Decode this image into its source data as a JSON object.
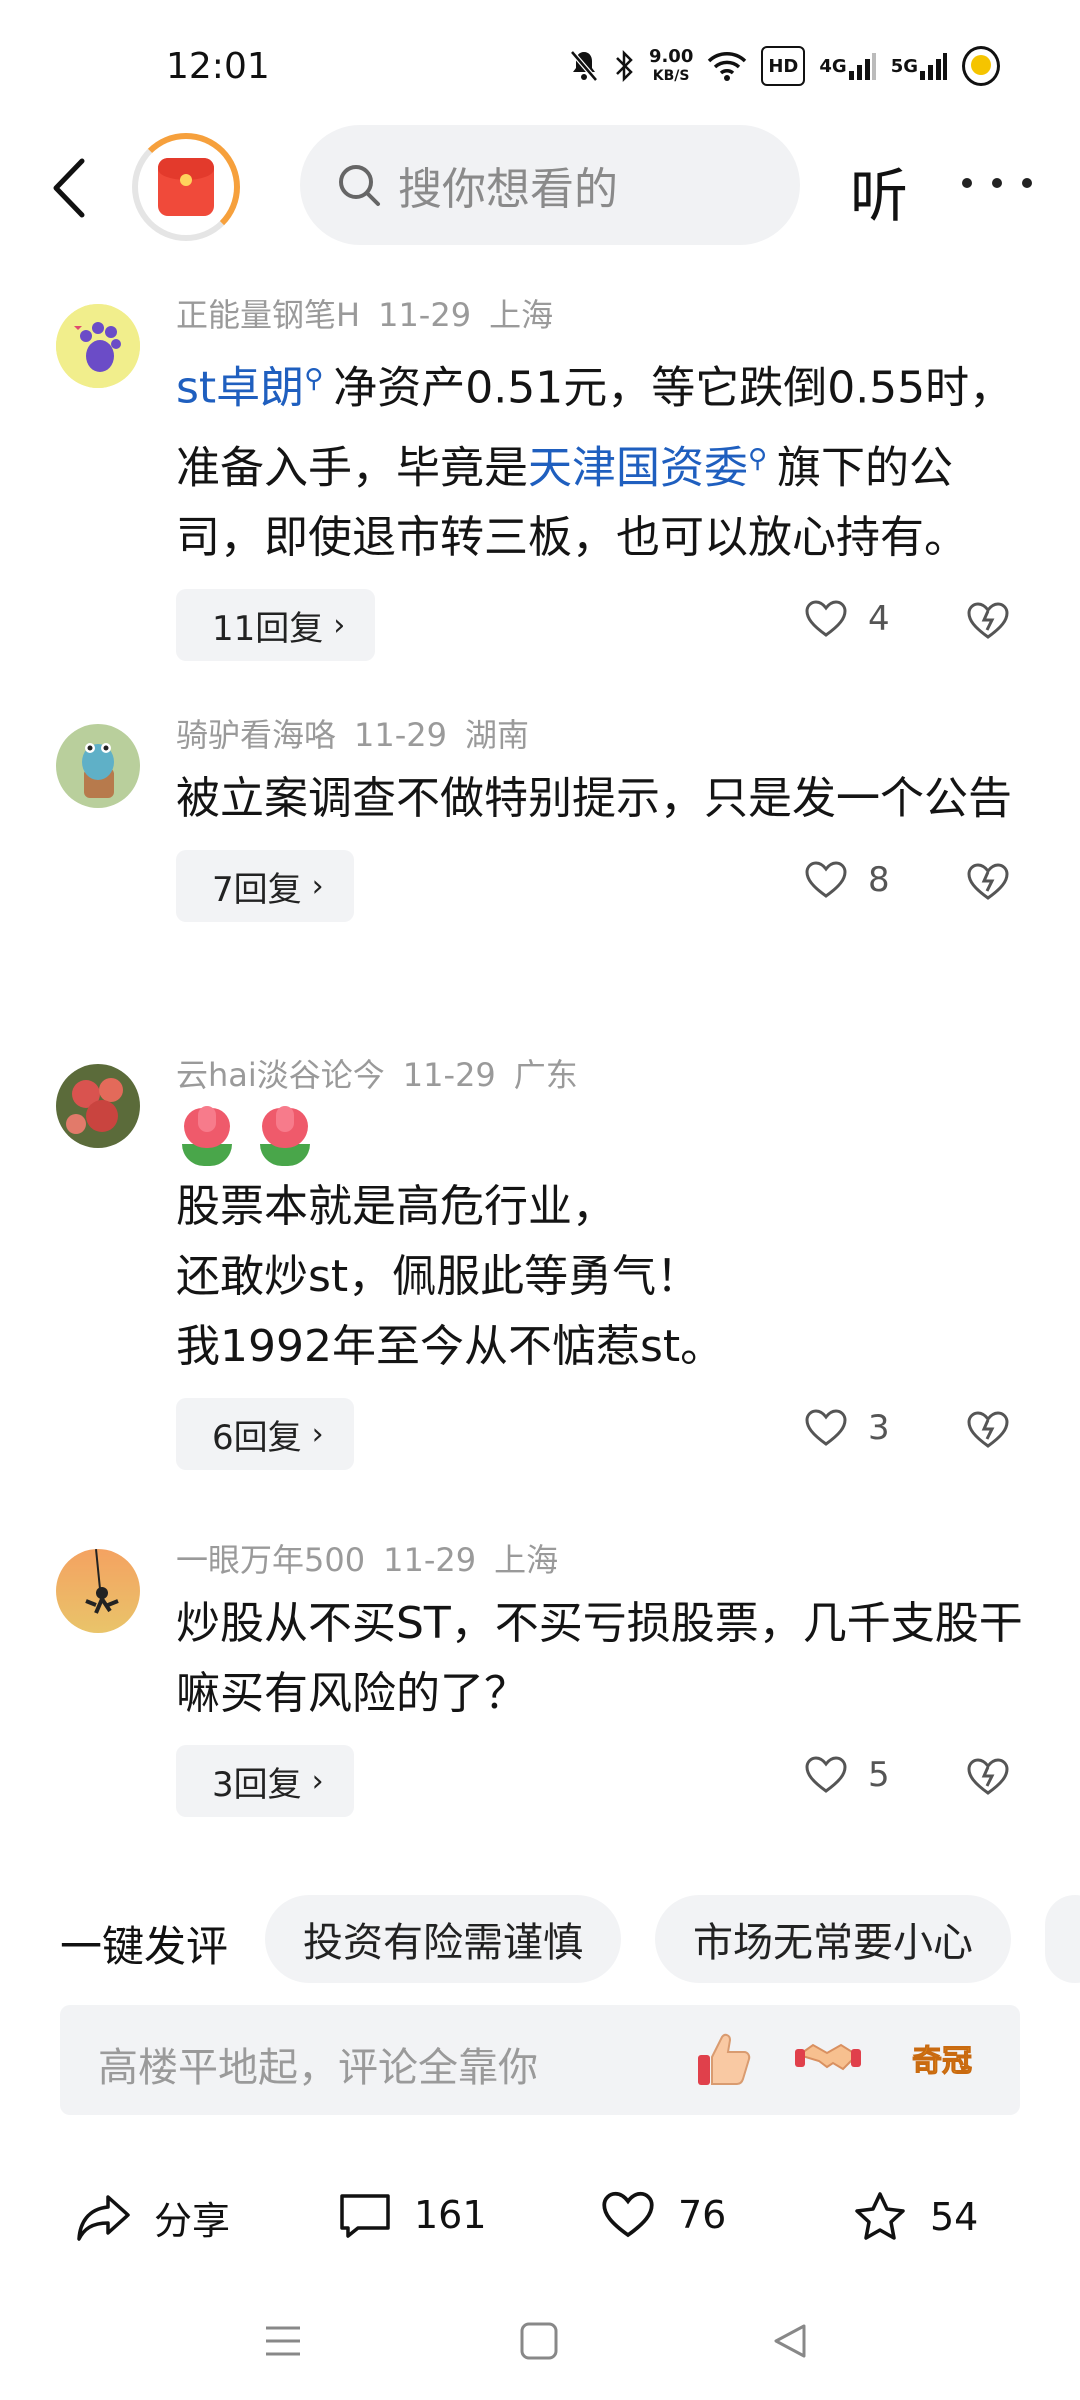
{
  "status_bar": {
    "time": "12:01",
    "net_speed_value": "9.00",
    "net_speed_unit": "KB/S",
    "hd_badge": "HD",
    "signal_1": "4G",
    "signal_2": "5G"
  },
  "header": {
    "search_placeholder": "搜你想看的",
    "listen_label": "听"
  },
  "comments": [
    {
      "user": "正能量钢笔H",
      "date": "11-29",
      "location": "上海",
      "link1": "st卓朗",
      "text1": "净资产0.51元，等它跌倒0.55时，准备入手，毕竟是",
      "link2": "天津国资委",
      "text2": "旗下的公司，即使退市转三板，也可以放心持有。",
      "replies": "11回复",
      "likes": "4"
    },
    {
      "user": "骑驴看海咯",
      "date": "11-29",
      "location": "湖南",
      "text": "被立案调查不做特别提示，只是发一个公告",
      "replies": "7回复",
      "likes": "8"
    },
    {
      "user": "云hai淡谷论今",
      "date": "11-29",
      "location": "广东",
      "emoji": "tulip-emoji",
      "line1": "股票本就是高危行业，",
      "line2": "还敢炒st，佩服此等勇气！",
      "line3": "我1992年至今从不惦惹st。",
      "replies": "6回复",
      "likes": "3"
    },
    {
      "user": "一眼万年500",
      "date": "11-29",
      "location": "上海",
      "text": "炒股从不买ST，不买亏损股票，几千支股干嘛买有风险的了？",
      "replies": "3回复",
      "likes": "5"
    }
  ],
  "quick_comment": {
    "label": "一键发评",
    "chips": [
      "投资有险需谨慎",
      "市场无常要小心"
    ]
  },
  "comment_input": {
    "placeholder": "高楼平地起，评论全靠你",
    "emoji_icons": [
      "thumbs-up-icon",
      "handshake-icon",
      "qiguan-icon"
    ],
    "qiguan_text": "奇冠"
  },
  "action_bar": {
    "share_label": "分享",
    "comment_count": "161",
    "like_count": "76",
    "favorite_count": "54"
  },
  "colors": {
    "link": "#1f5fbf",
    "meta": "#9a9a9a",
    "chip_bg": "#f2f3f5"
  }
}
